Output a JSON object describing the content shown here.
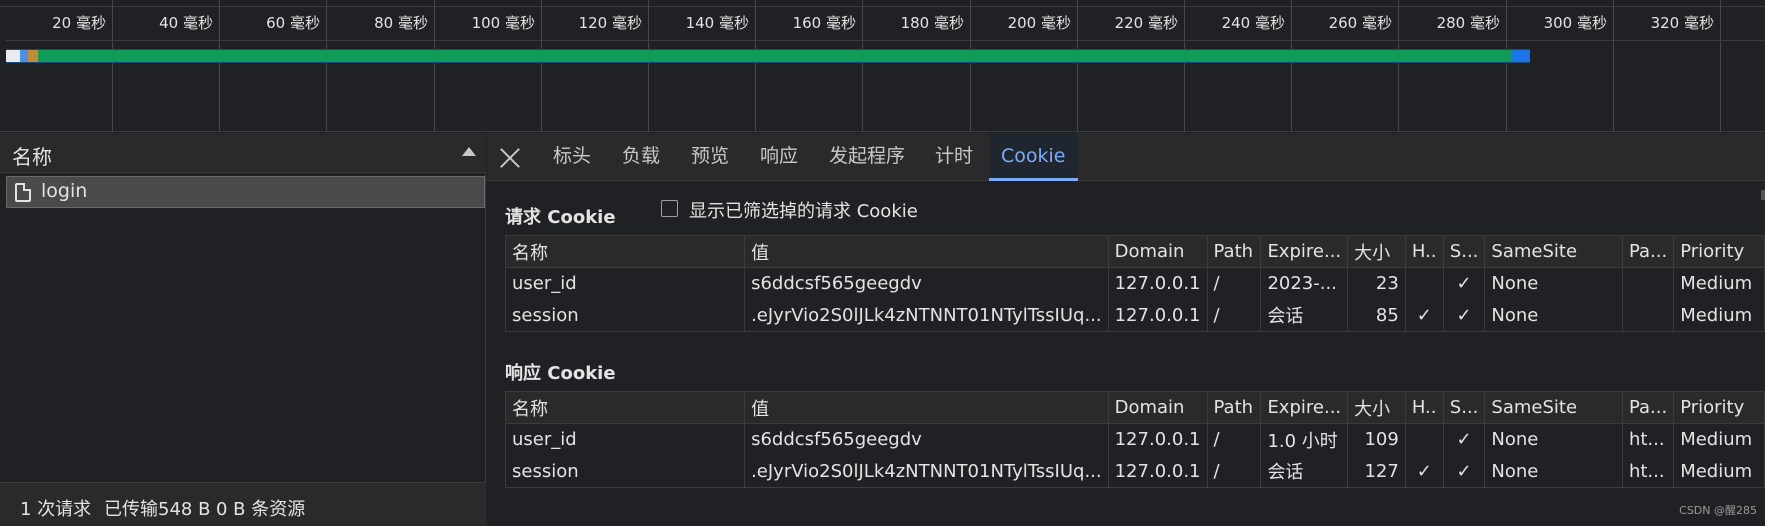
{
  "timeline": {
    "ticks": [
      {
        "label": "20 毫秒"
      },
      {
        "label": "40 毫秒"
      },
      {
        "label": "60 毫秒"
      },
      {
        "label": "80 毫秒"
      },
      {
        "label": "100 毫秒"
      },
      {
        "label": "120 毫秒"
      },
      {
        "label": "140 毫秒"
      },
      {
        "label": "160 毫秒"
      },
      {
        "label": "180 毫秒"
      },
      {
        "label": "200 毫秒"
      },
      {
        "label": "220 毫秒"
      },
      {
        "label": "240 毫秒"
      },
      {
        "label": "260 毫秒"
      },
      {
        "label": "280 毫秒"
      },
      {
        "label": "300 毫秒"
      },
      {
        "label": "320 毫秒"
      }
    ],
    "colors": {
      "queue": "#e8eaed",
      "stalled": "#4d8fe0",
      "connect": "#c68a3b",
      "waiting": "#0f9d58",
      "download": "#1a73e8"
    }
  },
  "request_list": {
    "header": "名称",
    "items": [
      {
        "name": "login"
      }
    ],
    "status": {
      "requests": "1 次请求",
      "transferred": "已传输548 B",
      "resources": "0 B 条资源"
    }
  },
  "detail": {
    "tabs": [
      "标头",
      "负载",
      "预览",
      "响应",
      "发起程序",
      "计时",
      "Cookie"
    ],
    "active_tab": "Cookie",
    "request_cookies": {
      "title": "请求 Cookie",
      "filter_label": "显示已筛选掉的请求 Cookie",
      "columns": [
        "名称",
        "值",
        "Domain",
        "Path",
        "Expire...",
        "大小",
        "H..",
        "S...",
        "SameSite",
        "Pa...",
        "Priority"
      ],
      "rows": [
        {
          "name": "user_id",
          "value": "s6ddcsf565geegdv",
          "domain": "127.0.0.1",
          "path": "/",
          "expires": "2023-...",
          "size": "23",
          "http": "",
          "secure": "✓",
          "samesite": "None",
          "partition": "",
          "priority": "Medium"
        },
        {
          "name": "session",
          "value": ".eJyrVio2S0lJLk4zNTNNT01NTylTssIUq...",
          "domain": "127.0.0.1",
          "path": "/",
          "expires": "会话",
          "size": "85",
          "http": "✓",
          "secure": "✓",
          "samesite": "None",
          "partition": "",
          "priority": "Medium"
        }
      ]
    },
    "response_cookies": {
      "title": "响应 Cookie",
      "columns": [
        "名称",
        "值",
        "Domain",
        "Path",
        "Expire...",
        "大小",
        "H..",
        "S...",
        "SameSite",
        "Pa...",
        "Priority"
      ],
      "rows": [
        {
          "name": "user_id",
          "value": "s6ddcsf565geegdv",
          "domain": "127.0.0.1",
          "path": "/",
          "expires": "1.0 小时",
          "size": "109",
          "http": "",
          "secure": "✓",
          "samesite": "None",
          "partition": "ht...",
          "priority": "Medium"
        },
        {
          "name": "session",
          "value": ".eJyrVio2S0lJLk4zNTNNT01NTylTssIUq...",
          "domain": "127.0.0.1",
          "path": "/",
          "expires": "会话",
          "size": "127",
          "http": "✓",
          "secure": "✓",
          "samesite": "None",
          "partition": "ht...",
          "priority": "Medium"
        }
      ]
    }
  },
  "watermark": "CSDN @醒285"
}
